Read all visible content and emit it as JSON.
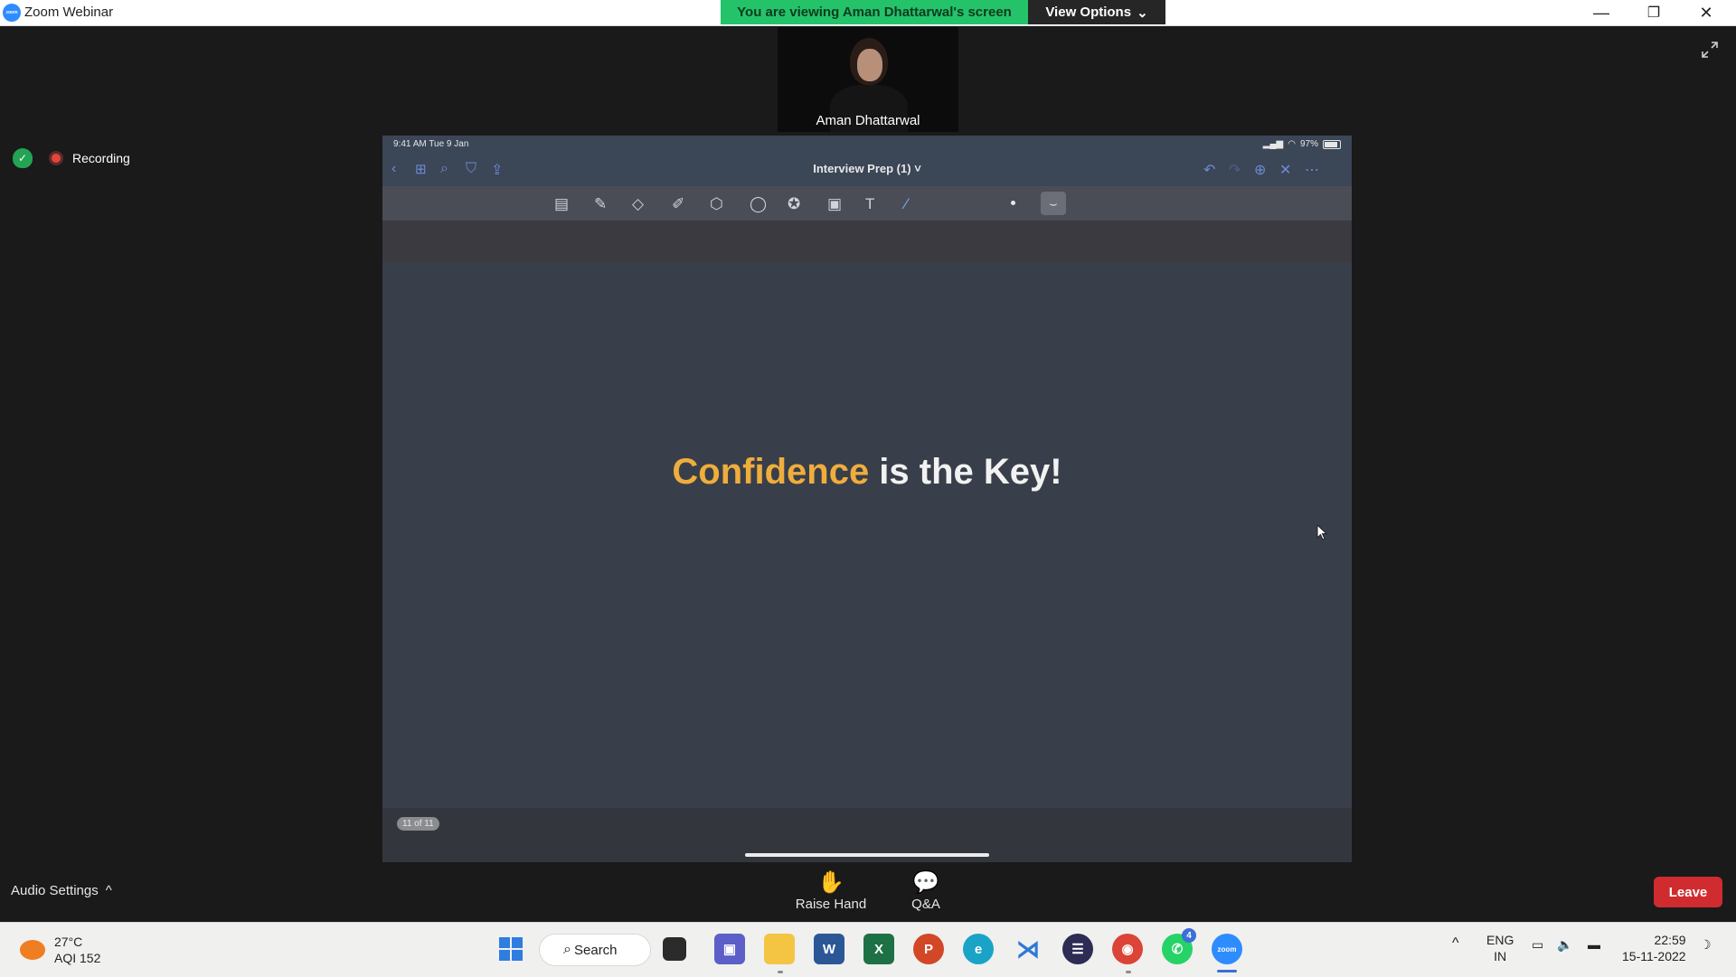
{
  "window": {
    "title": "Zoom Webinar",
    "logo_text": "zoom",
    "controls": {
      "minimize": "—",
      "restore": "❐",
      "close": "✕"
    }
  },
  "banner": {
    "viewing_text": "You are viewing Aman Dhattarwal's screen",
    "view_options": "View Options",
    "view_options_chevron": "⌄"
  },
  "video": {
    "participant_name": "Aman Dhattarwal"
  },
  "recording": {
    "label": "Recording"
  },
  "shared_screen": {
    "status_time": "9:41 AM  Tue 9 Jan",
    "battery": "97%",
    "doc_title": "Interview Prep (1)",
    "slide_text_accent": "Confidence",
    "slide_text_rest": " is the Key!",
    "page_indicator": "11 of 11",
    "colors": {
      "accent": "#f0ad3c",
      "slide_bg": "#383f4a"
    }
  },
  "controls": {
    "audio_settings": "Audio Settings",
    "audio_chevron": "^",
    "raise_hand": "Raise Hand",
    "qa": "Q&A",
    "leave": "Leave"
  },
  "taskbar": {
    "weather_temp": "27°C",
    "weather_aqi": "AQI 152",
    "search": "Search",
    "whatsapp_badge": "4",
    "lang_top": "ENG",
    "lang_bottom": "IN",
    "time": "22:59",
    "date": "15-11-2022"
  }
}
